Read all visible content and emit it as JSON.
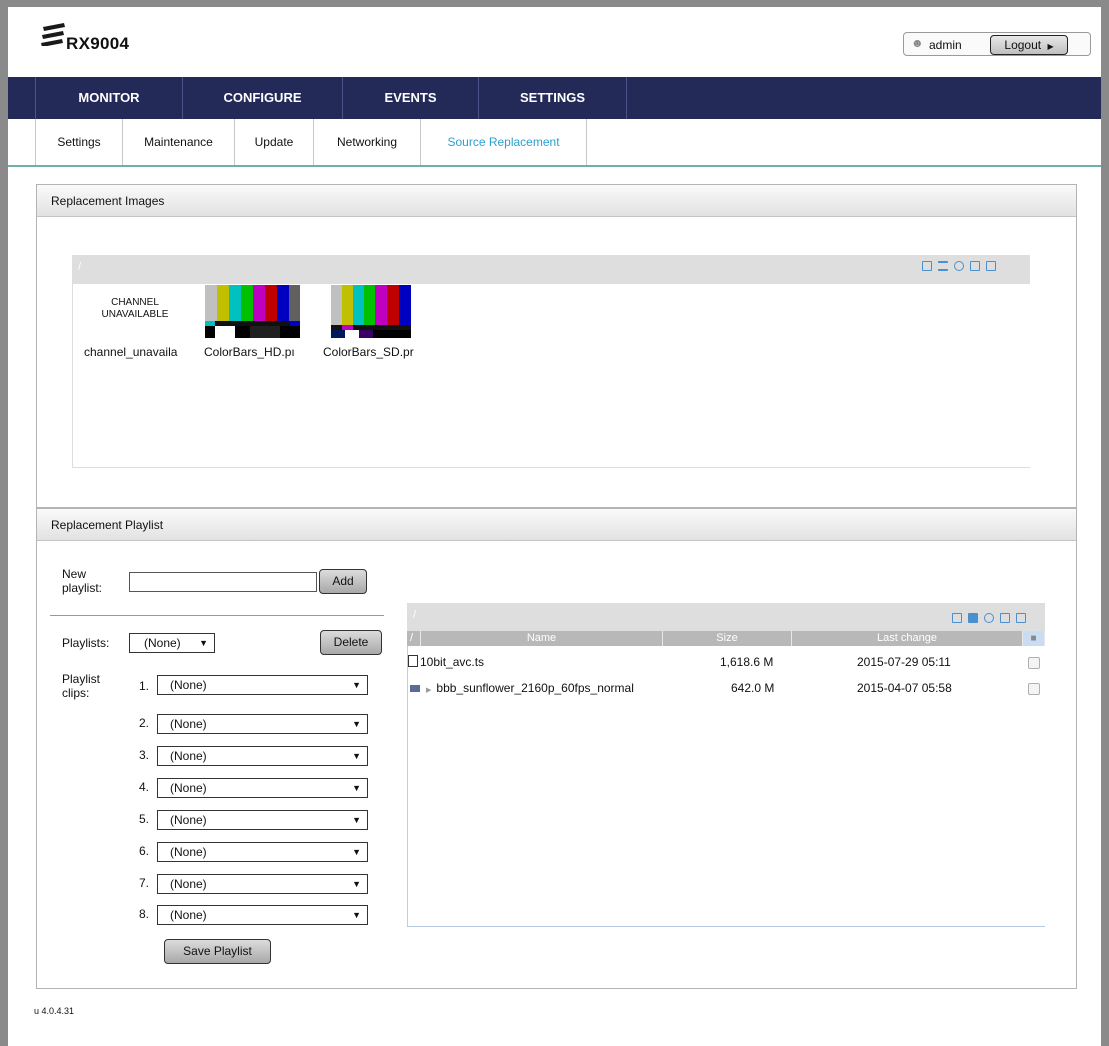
{
  "header": {
    "title": "RX9004",
    "user": "admin",
    "logout_label": "Logout"
  },
  "icons": {
    "logo": "ericsson-logo-icon",
    "user": "user-icon",
    "logout_arrow": "triangle-right-icon"
  },
  "main_nav": [
    {
      "label": "MONITOR"
    },
    {
      "label": "CONFIGURE"
    },
    {
      "label": "EVENTS"
    },
    {
      "label": "SETTINGS"
    }
  ],
  "sub_nav": [
    {
      "label": "Settings",
      "active": false
    },
    {
      "label": "Maintenance",
      "active": false
    },
    {
      "label": "Update",
      "active": false
    },
    {
      "label": "Networking",
      "active": false
    },
    {
      "label": "Source Replacement",
      "active": true
    }
  ],
  "images_panel": {
    "title": "Replacement Images",
    "path": "/",
    "placeholder_line1": "CHANNEL",
    "placeholder_line2": "UNAVAILABLE",
    "files": [
      {
        "name": "channel_unavaila"
      },
      {
        "name": "ColorBars_HD.pı"
      },
      {
        "name": "ColorBars_SD.pr"
      }
    ]
  },
  "playlist_panel": {
    "title": "Replacement Playlist",
    "new_playlist_label_1": "New",
    "new_playlist_label_2": "playlist:",
    "new_playlist_value": "",
    "add_label": "Add",
    "playlists_label": "Playlists:",
    "playlists_selected": "(None)",
    "delete_label": "Delete",
    "clips_label_1": "Playlist",
    "clips_label_2": "clips:",
    "clips": [
      {
        "num": "1.",
        "value": "(None)"
      },
      {
        "num": "2.",
        "value": "(None)"
      },
      {
        "num": "3.",
        "value": "(None)"
      },
      {
        "num": "4.",
        "value": "(None)"
      },
      {
        "num": "5.",
        "value": "(None)"
      },
      {
        "num": "6.",
        "value": "(None)"
      },
      {
        "num": "7.",
        "value": "(None)"
      },
      {
        "num": "8.",
        "value": "(None)"
      }
    ],
    "save_label": "Save Playlist"
  },
  "file_list": {
    "path": "/",
    "columns": {
      "sort": "/",
      "name": "Name",
      "size": "Size",
      "last_change": "Last change"
    },
    "rows": [
      {
        "name": "10bit_avc.ts",
        "size": "1,618.6 M",
        "date": "2015-07-29 05:11",
        "icon": "file-icon"
      },
      {
        "name": "bbb_sunflower_2160p_60fps_normal",
        "size": "642.0 M",
        "date": "2015-04-07 05:58",
        "icon": "video-file-icon"
      }
    ]
  },
  "footer": {
    "version": "u 4.0.4.31"
  },
  "colors": {
    "nav_bg": "#232a58",
    "accent": "#2ba0d0",
    "divider": "#6cb0a8"
  }
}
